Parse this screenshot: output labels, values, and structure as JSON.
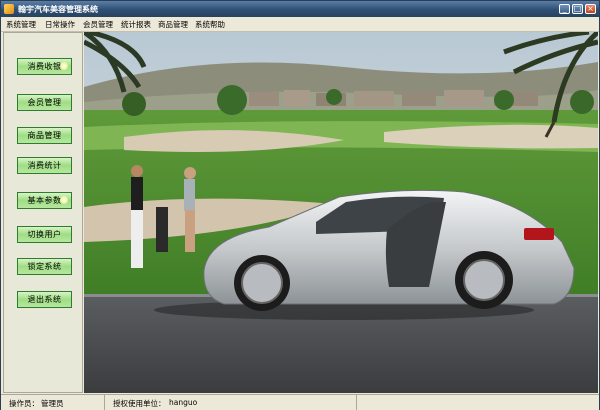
{
  "window": {
    "title": "翰宇汽车美容管理系统",
    "controls": {
      "minimize": "_",
      "maximize": "□",
      "close": "×"
    }
  },
  "menu": [
    {
      "label": "系统管理"
    },
    {
      "label": "日常操作"
    },
    {
      "label": "会员管理"
    },
    {
      "label": "统计报表"
    },
    {
      "label": "商品管理"
    },
    {
      "label": "系统帮助"
    }
  ],
  "sidebar": {
    "buttons": [
      {
        "label": "消费收银"
      },
      {
        "label": "会员管理"
      },
      {
        "label": "商品管理"
      },
      {
        "label": "消费统计"
      },
      {
        "label": "基本参数"
      },
      {
        "label": "切换用户"
      },
      {
        "label": "锁定系统"
      },
      {
        "label": "退出系统"
      }
    ]
  },
  "statusbar": {
    "operator_label": "操作员：",
    "operator_value": "管理员",
    "license_label": "授权使用单位：",
    "license_value": "hanguo"
  },
  "colors": {
    "titlebar": "#2f4f73",
    "button_green": "#9fdd84",
    "button_border": "#2f7c2f"
  },
  "icons": {
    "app": "app-logo-icon",
    "minimize": "minimize-icon",
    "maximize": "maximize-icon",
    "close": "close-icon"
  }
}
